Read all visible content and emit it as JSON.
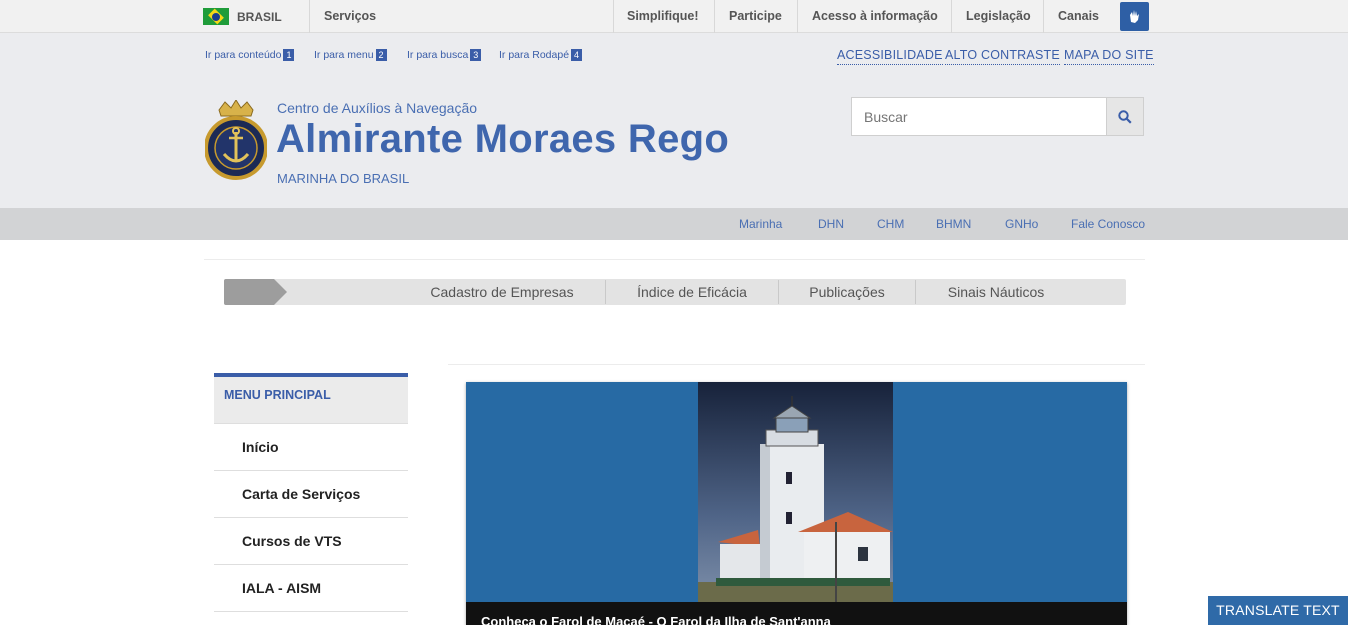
{
  "govbar": {
    "brasil": "BRASIL",
    "servicos": "Serviços",
    "links": [
      "Simplifique!",
      "Participe",
      "Acesso à informação",
      "Legislação",
      "Canais"
    ]
  },
  "skip": [
    {
      "label": "Ir para conteúdo",
      "num": "1"
    },
    {
      "label": "Ir para menu",
      "num": "2"
    },
    {
      "label": "Ir para busca",
      "num": "3"
    },
    {
      "label": "Ir para Rodapé",
      "num": "4"
    }
  ],
  "toplinks": [
    "ACESSIBILIDADE",
    "ALTO CONTRASTE",
    "MAPA DO SITE"
  ],
  "header": {
    "subtitle": "Centro de Auxílios à Navegação",
    "title": "Almirante Moraes Rego",
    "org": "MARINHA DO BRASIL",
    "emblem_text": "MARINHA DO BRASIL"
  },
  "search": {
    "placeholder": "Buscar"
  },
  "services": [
    "Marinha",
    "DHN",
    "CHM",
    "BHMN",
    "GNHo",
    "Fale Conosco"
  ],
  "tabs": [
    "Cadastro de Empresas",
    "Índice de Eficácia",
    "Publicações",
    "Sinais Náuticos"
  ],
  "sidemenu": {
    "title": "MENU PRINCIPAL",
    "items": [
      "Início",
      "Carta de Serviços",
      "Cursos de VTS",
      "IALA - AISM"
    ]
  },
  "carousel": {
    "caption": "Conheça o Farol de Macaé - O Farol da Ilha de Sant'anna"
  },
  "translate": "TRANSLATE TEXT",
  "colors": {
    "brand_blue": "#3f66ad",
    "carousel_bg": "#276aa4"
  }
}
